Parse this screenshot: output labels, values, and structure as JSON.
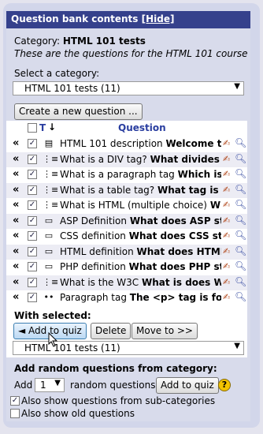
{
  "header": {
    "title": "Question bank contents",
    "hide_label": "[Hide]"
  },
  "category": {
    "label": "Category:",
    "name": "HTML 101 tests",
    "description": "These are the questions for the HTML 101 course"
  },
  "select_category": {
    "label": "Select a category:",
    "value": "HTML 101 tests (11)"
  },
  "create_button": "Create a new question ...",
  "table": {
    "col_t": "T",
    "col_question": "Question",
    "rows": [
      {
        "type_icon": "description-icon",
        "glyph": "▤",
        "name": "HTML 101 description",
        "text": "Welcome to"
      },
      {
        "type_icon": "multichoice-icon",
        "glyph": "⋮≡",
        "name": "What is a DIV tag?",
        "text": "What divides c"
      },
      {
        "type_icon": "multichoice-icon",
        "glyph": "⋮≡",
        "name": "What is a paragraph tag",
        "text": "Which is a"
      },
      {
        "type_icon": "multichoice-icon",
        "glyph": "⋮≡",
        "name": "What is a table tag?",
        "text": "What tag is fo"
      },
      {
        "type_icon": "multichoice-icon",
        "glyph": "⋮≡",
        "name": "What is HTML (multiple choice)",
        "text": "What"
      },
      {
        "type_icon": "shortanswer-icon",
        "glyph": "▭",
        "name": "ASP Definition",
        "text": "What does ASP sta"
      },
      {
        "type_icon": "shortanswer-icon",
        "glyph": "▭",
        "name": "CSS definition",
        "text": "What does CSS sta"
      },
      {
        "type_icon": "shortanswer-icon",
        "glyph": "▭",
        "name": "HTML definition",
        "text": "What does HTML"
      },
      {
        "type_icon": "shortanswer-icon",
        "glyph": "▭",
        "name": "PHP definition",
        "text": "What does PHP sta"
      },
      {
        "type_icon": "multichoice-icon",
        "glyph": "⋮≡",
        "name": "What is the W3C",
        "text": "What is does W"
      },
      {
        "type_icon": "truefalse-icon",
        "glyph": "••",
        "name": "Paragraph tag",
        "text": "The <p> tag is for r"
      }
    ]
  },
  "with_selected": {
    "label": "With selected:",
    "add_to_quiz": "◄ Add to quiz",
    "delete": "Delete",
    "move_to": "Move to >>",
    "move_target": "HTML 101 tests (11)"
  },
  "random": {
    "title": "Add random questions from category:",
    "add_label": "Add",
    "count": "1",
    "after_label": "random questions",
    "button": "Add to quiz",
    "help": "?"
  },
  "options": {
    "subcategories": "Also show questions from sub-categories",
    "old": "Also show old questions"
  },
  "colors": {
    "header": "#35418c",
    "panel": "#d8dbeb"
  }
}
